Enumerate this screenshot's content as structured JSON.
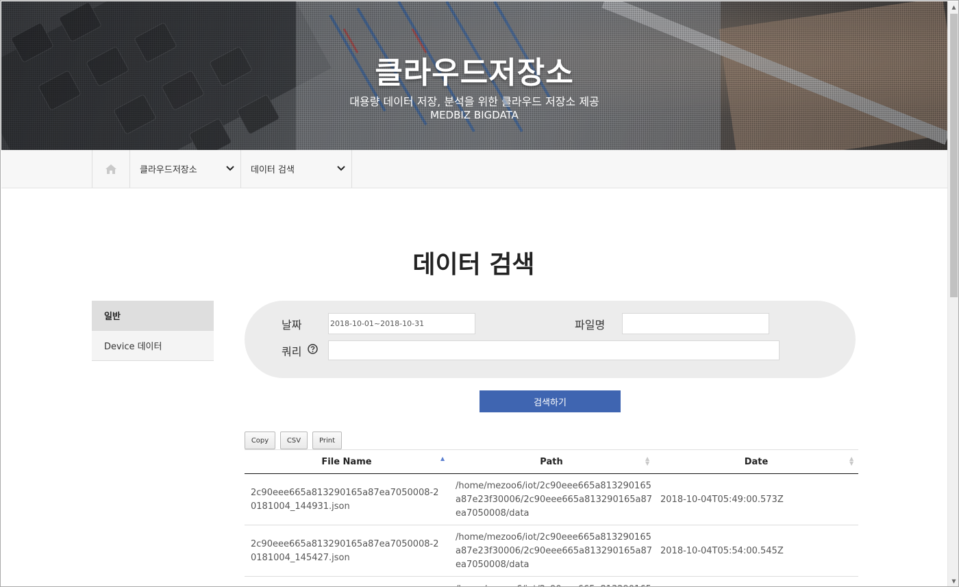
{
  "hero": {
    "title": "클라우드저장소",
    "subtitle": "대용량 데이터 저장, 분석을 위한 클라우드 저장소 제공",
    "subtitle2": "MEDBIZ BIGDATA"
  },
  "nav": {
    "home_icon": "home-icon",
    "menu1": "클라우드저장소",
    "menu2": "데이터 검색"
  },
  "page": {
    "title": "데이터 검색"
  },
  "sidebar": {
    "items": [
      {
        "label": "일반",
        "active": true
      },
      {
        "label": "Device 데이터",
        "active": false
      }
    ]
  },
  "search": {
    "date_label": "날짜",
    "date_value": "2018-10-01~2018-10-31",
    "filename_label": "파일명",
    "filename_value": "",
    "query_label": "쿼리",
    "query_value": "",
    "button": "검색하기"
  },
  "export": {
    "copy": "Copy",
    "csv": "CSV",
    "print": "Print"
  },
  "table": {
    "headers": [
      "File Name",
      "Path",
      "Date"
    ],
    "rows": [
      {
        "file_name": "2c90eee665a813290165a87ea7050008-20181004_144931.json",
        "path": "/home/mezoo6/iot/2c90eee665a813290165a87e23f30006/2c90eee665a813290165a87ea7050008/data",
        "date": "2018-10-04T05:49:00.573Z"
      },
      {
        "file_name": "2c90eee665a813290165a87ea7050008-20181004_145427.json",
        "path": "/home/mezoo6/iot/2c90eee665a813290165a87e23f30006/2c90eee665a813290165a87ea7050008/data",
        "date": "2018-10-04T05:54:00.545Z"
      },
      {
        "file_name": "",
        "path": "/home/mezoo6/iot/2c90eee665a813290165",
        "date": ""
      }
    ]
  },
  "colors": {
    "accent": "#3f65b1",
    "panel": "#ececec",
    "sidebar_active": "#dedede"
  }
}
